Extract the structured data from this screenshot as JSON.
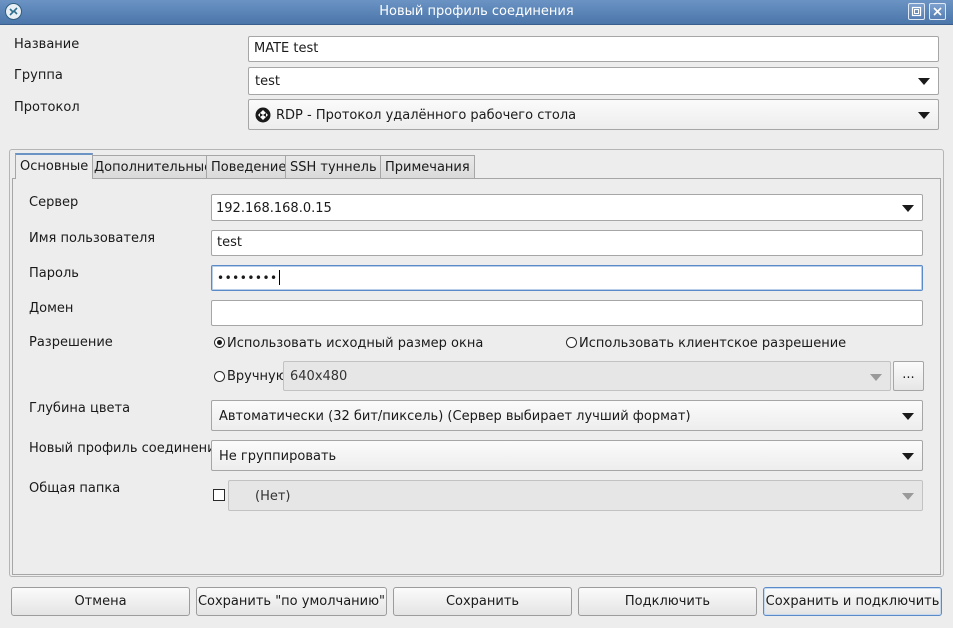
{
  "window": {
    "title": "Новый профиль соединения"
  },
  "profile": {
    "name_label": "Название",
    "name_value": "MATE test",
    "group_label": "Группа",
    "group_value": "test",
    "protocol_label": "Протокол",
    "protocol_value": "RDP - Протокол удалённого рабочего стола"
  },
  "tabs": [
    {
      "label": "Основные",
      "active": true
    },
    {
      "label": "Дополнительные",
      "active": false
    },
    {
      "label": "Поведение",
      "active": false
    },
    {
      "label": "SSH туннель",
      "active": false
    },
    {
      "label": "Примечания",
      "active": false
    }
  ],
  "basic": {
    "server_label": "Сервер",
    "server_value": "192.168.168.0.15",
    "username_label": "Имя пользователя",
    "username_value": "test",
    "password_label": "Пароль",
    "password_value": "••••••••",
    "domain_label": "Домен",
    "domain_value": "",
    "resolution_label": "Разрешение",
    "resolution_options": [
      {
        "label": "Использовать исходный размер окна",
        "checked": true
      },
      {
        "label": "Использовать клиентское разрешение",
        "checked": false
      },
      {
        "label": "Вручную",
        "checked": false
      }
    ],
    "manual_resolution_value": "640x480",
    "manual_resolution_button": "...",
    "color_depth_label": "Глубина цвета",
    "color_depth_value": "Автоматически (32 бит/пиксель) (Сервер выбирает лучший формат)",
    "grouping_label": "Новый профиль соединения",
    "grouping_value": "Не группировать",
    "shared_folder_label": "Общая папка",
    "shared_folder_checked": false,
    "shared_folder_value": "(Нет)"
  },
  "buttons": {
    "cancel": "Отмена",
    "save_default": "Сохранить \"по умолчанию\"",
    "save": "Сохранить",
    "connect": "Подключить",
    "save_connect": "Сохранить и подключить"
  },
  "colors": {
    "titlebar": "#5a83b8",
    "focus": "#5b8ac8",
    "window_bg": "#ededed"
  }
}
